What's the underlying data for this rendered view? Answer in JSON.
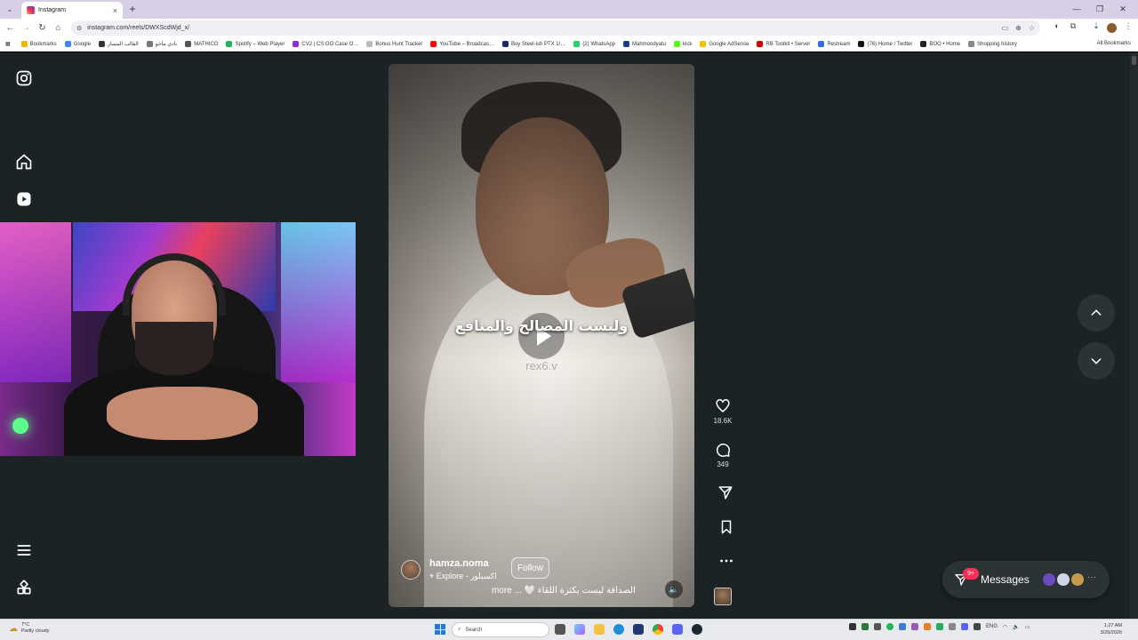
{
  "browser": {
    "tab_title": "Instagram",
    "tab_close": "×",
    "new_tab": "+",
    "url": "instagram.com/reels/DWXScdWjd_x/",
    "window_controls": [
      "—",
      "❐",
      "✕"
    ],
    "bookmarks": [
      {
        "label": "Bookmarks",
        "color": "#f2b400"
      },
      {
        "label": "Google",
        "color": "#4285f4"
      },
      {
        "label": "القالب المسار",
        "color": "#333333"
      },
      {
        "label": "نادي ماخو",
        "color": "#777777"
      },
      {
        "label": "MATHICO",
        "color": "#555555"
      },
      {
        "label": "Spotify – Web Player",
        "color": "#1db954"
      },
      {
        "label": "CV2 | CS:GO Case O…",
        "color": "#8a2be2"
      },
      {
        "label": "Bonus Hunt Tracker",
        "color": "#bbbbbb"
      },
      {
        "label": "YouTube – Broadcas…",
        "color": "#ff0000"
      },
      {
        "label": "Buy Steel-ish PTX 1/…",
        "color": "#1b2a6b"
      },
      {
        "label": "(2) WhatsApp",
        "color": "#25d366"
      },
      {
        "label": "Mahmoodyatu",
        "color": "#1a3a8a"
      },
      {
        "label": "kick",
        "color": "#53fc18"
      },
      {
        "label": "Google AdSense",
        "color": "#fbbc05"
      },
      {
        "label": "RB Toolkit • Server",
        "color": "#d00000"
      },
      {
        "label": "Restream",
        "color": "#2f6fe0"
      },
      {
        "label": "(76) Home / Twitter",
        "color": "#111111"
      },
      {
        "label": "BOO • Home",
        "color": "#222222"
      },
      {
        "label": "Shopping history",
        "color": "#888888"
      }
    ],
    "all_bookmarks": "All Bookmarks"
  },
  "sidebar": {
    "icons": [
      "instagram-logo-icon",
      "home-icon",
      "reels-icon",
      "menu-icon",
      "more-apps-icon"
    ]
  },
  "reel": {
    "subtitle": "وليست المصالح والمنافع",
    "watermark": "rex6.v",
    "author_name": "hamza.noma",
    "location": "Explore - اكسبلور",
    "follow_label": "Follow",
    "caption": "more ... 🤍 الصداقة ليست بكثرة اللقاء",
    "likes": "18.6K",
    "comments": "349"
  },
  "messages": {
    "label": "Messages",
    "badge": "9+",
    "more": "···"
  },
  "taskbar": {
    "weather_temp": "7°C",
    "weather_desc": "Partly cloudy",
    "search_placeholder": "Search",
    "tray_lang": "ENG",
    "time": "1:27 AM",
    "date": "3/29/2026"
  }
}
